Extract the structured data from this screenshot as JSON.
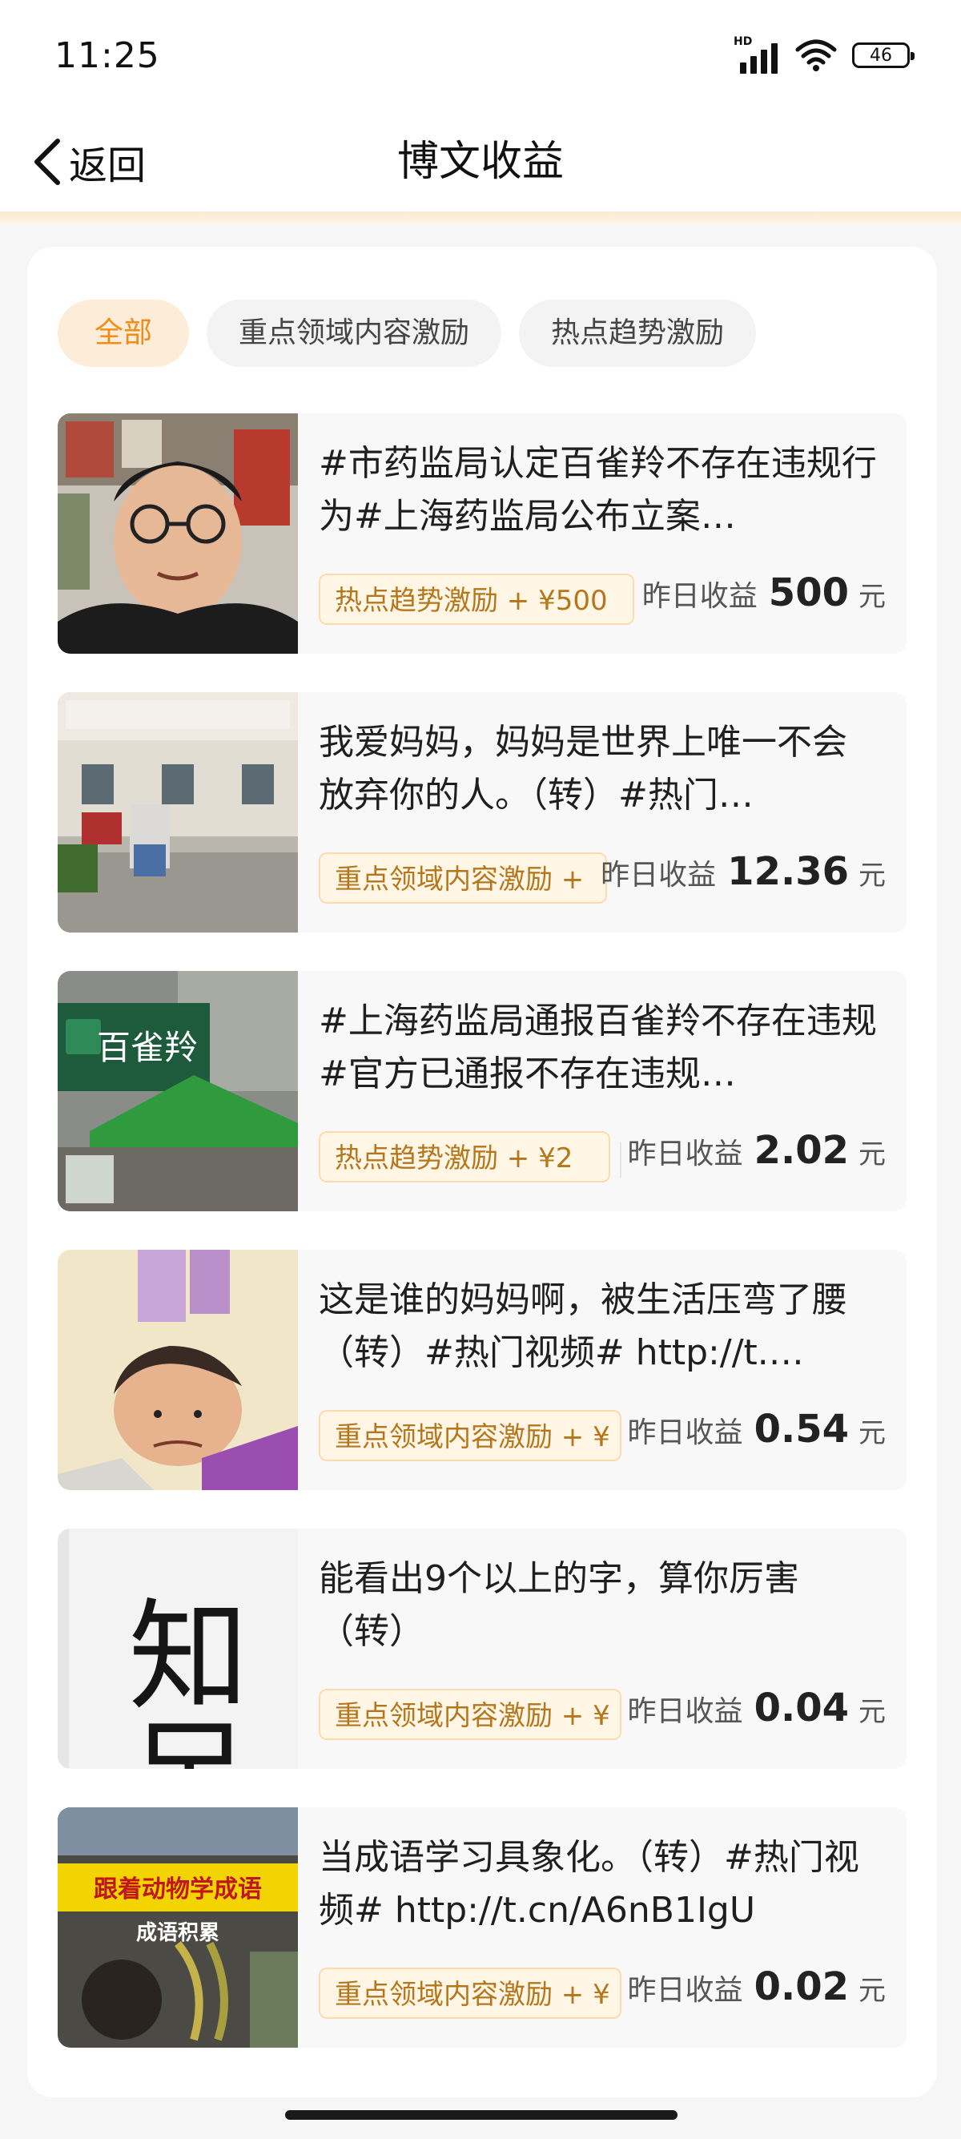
{
  "status_bar": {
    "time": "11:25",
    "network": "HD",
    "battery": "46"
  },
  "nav": {
    "back_label": "返回",
    "title": "博文收益"
  },
  "filters": [
    "全部",
    "重点领域内容激励",
    "热点趋势激励"
  ],
  "posts": [
    {
      "title": "#市药监局认定百雀羚不存在违规行为#上海药监局公布立案…",
      "tag": "热点趋势激励 + ¥500",
      "earn_label": "昨日收益",
      "earn_value": "500",
      "unit": "元"
    },
    {
      "title": "我爱妈妈，妈妈是世界上唯一不会放弃你的人。（转）#热门…",
      "tag": "重点领域内容激励 +",
      "earn_label": "昨日收益",
      "earn_value": "12.36",
      "unit": "元"
    },
    {
      "title": "#上海药监局通报百雀羚不存在违规#官方已通报不存在违规…",
      "tag": "热点趋势激励 + ¥2",
      "earn_label": "昨日收益",
      "earn_value": "2.02",
      "unit": "元"
    },
    {
      "title": "这是谁的妈妈啊，被生活压弯了腰（转）#热门视频# http://t.…",
      "tag": "重点领域内容激励 + ¥",
      "earn_label": "昨日收益",
      "earn_value": "0.54",
      "unit": "元"
    },
    {
      "title": "能看出9个以上的字，算你厉害（转）",
      "tag": "重点领域内容激励 + ¥",
      "earn_label": "昨日收益",
      "earn_value": "0.04",
      "unit": "元"
    },
    {
      "title": "当成语学习具象化。（转）#热门视频# http://t.cn/A6nB1IgU",
      "tag": "重点领域内容激励 + ¥",
      "earn_label": "昨日收益",
      "earn_value": "0.02",
      "unit": "元"
    }
  ],
  "thumb_text": {
    "store_sign": "百雀羚",
    "hanzi": "知足",
    "banner_1": "跟着动物学成语",
    "banner_2": "成语积累"
  },
  "colors": {
    "accent": "#f08c18",
    "tag_text": "#b5761c",
    "tag_bg": "#fff6e6"
  }
}
